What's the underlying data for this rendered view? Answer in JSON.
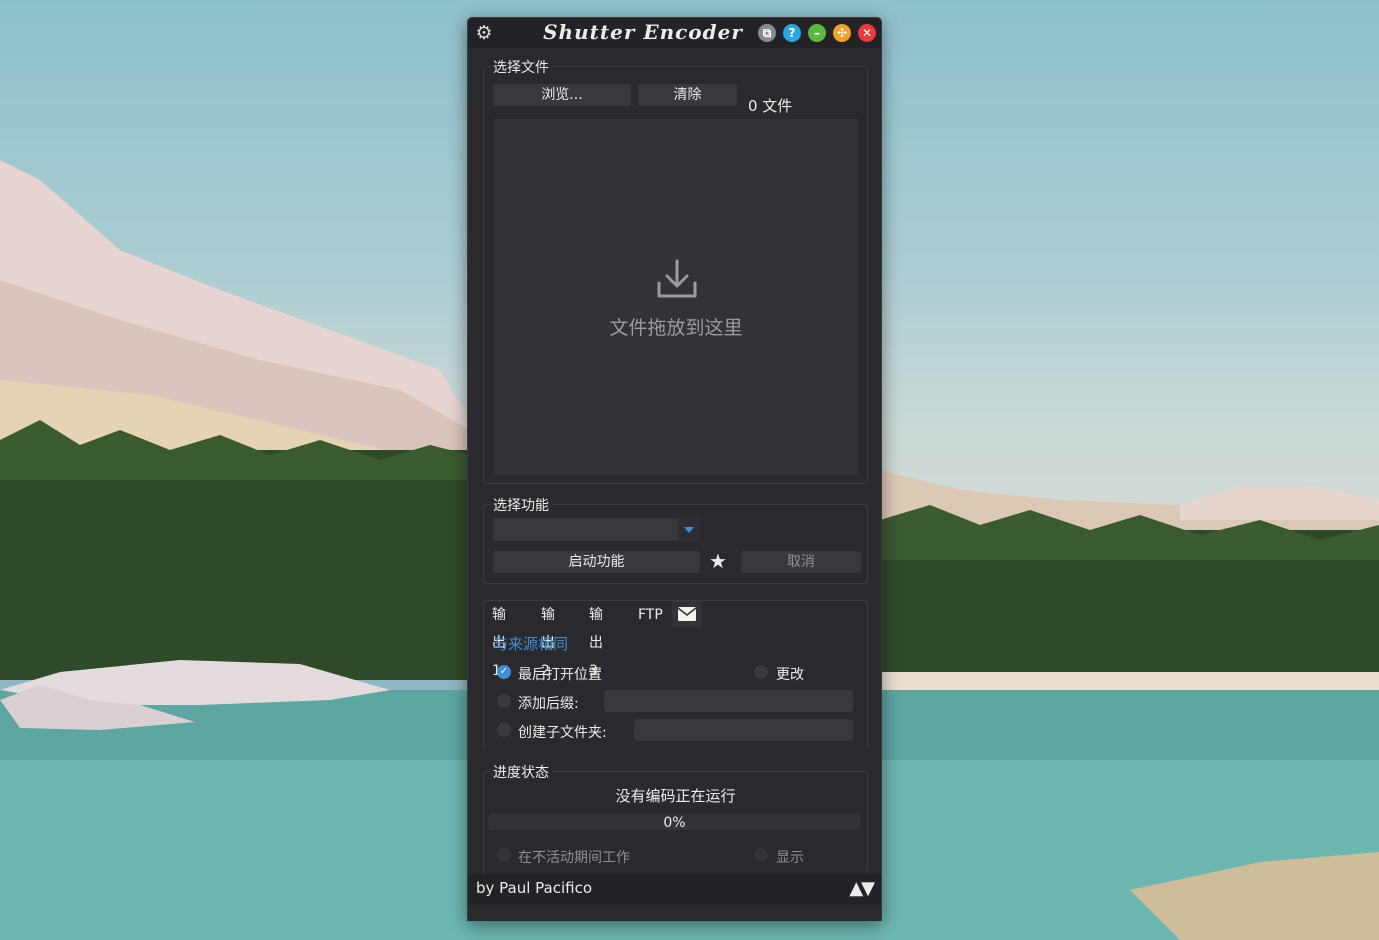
{
  "window": {
    "title": "Shutter Encoder",
    "title_buttons": {
      "restore": "⧉",
      "help": "?",
      "minimize": "–",
      "maximize": "✣",
      "close": "✕"
    }
  },
  "select_files": {
    "legend": "选择文件",
    "browse_label": "浏览...",
    "clear_label": "清除",
    "file_count": "0 文件",
    "drop_text": "文件拖放到这里"
  },
  "select_function": {
    "legend": "选择功能",
    "combo_value": "",
    "start_label": "启动功能",
    "cancel_label": "取消"
  },
  "output": {
    "tabs": [
      "输出1",
      "输出2",
      "输出3",
      "FTP"
    ],
    "same_as_source": "与来源相同",
    "last_open_location": {
      "label": "最后打开位置",
      "checked": true
    },
    "change": {
      "label": "更改",
      "checked": false
    },
    "add_suffix": {
      "label": "添加后缀:",
      "value": ""
    },
    "create_subfolder": {
      "label": "创建子文件夹:",
      "value": ""
    }
  },
  "progress": {
    "legend": "进度状态",
    "status": "没有编码正在运行",
    "percent_text": "0%",
    "percent": 0,
    "work_while_idle": "在不活动期间工作",
    "display": "显示"
  },
  "footer": {
    "author": "by Paul Pacifico",
    "arrows": "▲▼"
  },
  "colors": {
    "accent": "#3d8fd1",
    "window_bg": "#2a2a2e"
  }
}
